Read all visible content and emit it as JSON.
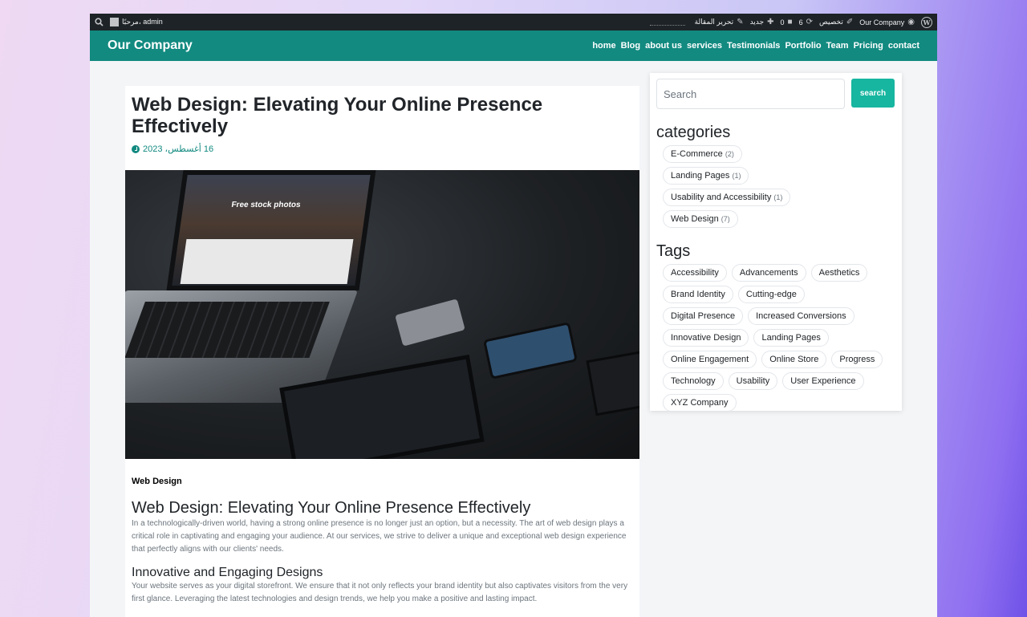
{
  "adminbar": {
    "site_name": "Our Company",
    "customize": "تخصيص",
    "updates_count": "6",
    "comments_count": "0",
    "new_label": "جديد",
    "edit_post": "تحرير المقالة",
    "greeting": "مرحبًا، admin"
  },
  "navbar": {
    "brand": "Our Company",
    "links": [
      "home",
      "Blog",
      "about us",
      "services",
      "Testimonials",
      "Portfolio",
      "Team",
      "Pricing",
      "contact"
    ]
  },
  "post": {
    "title": "Web Design: Elevating Your Online Presence Effectively",
    "date": "16 أغسطس، 2023",
    "image_text": "Free stock photos",
    "category": "Web Design",
    "heading": "Web Design: Elevating Your Online Presence Effectively",
    "para1": "In a technologically-driven world, having a strong online presence is no longer just an option, but a necessity. The art of web design plays a critical role in captivating and engaging your audience. At our services, we strive to deliver a unique and exceptional web design experience that perfectly aligns with our clients' needs.",
    "subheading": "Innovative and Engaging Designs",
    "para2": "Your website serves as your digital storefront. We ensure that it not only reflects your brand identity but also captivates visitors from the very first glance. Leveraging the latest technologies and design trends, we help you make a positive and lasting impact."
  },
  "sidebar": {
    "search_placeholder": "Search",
    "search_button": "search",
    "categories_title": "categories",
    "categories": [
      {
        "name": "E-Commerce",
        "count": "(2)"
      },
      {
        "name": "Landing Pages",
        "count": "(1)"
      },
      {
        "name": "Usability and Accessibility",
        "count": "(1)"
      },
      {
        "name": "Web Design",
        "count": "(7)"
      }
    ],
    "tags_title": "Tags",
    "tags": [
      "Accessibility",
      "Advancements",
      "Aesthetics",
      "Brand Identity",
      "Cutting-edge",
      "Digital Presence",
      "Increased Conversions",
      "Innovative Design",
      "Landing Pages",
      "Online Engagement",
      "Online Store",
      "Progress",
      "Technology",
      "Usability",
      "User Experience",
      "XYZ Company"
    ]
  },
  "colors": {
    "navbar": "#128a80",
    "accent": "#17b6a0",
    "adminbar": "#1d2327"
  },
  "icons": [
    "wordpress-icon",
    "dashboard-icon",
    "brush-icon",
    "refresh-icon",
    "comment-icon",
    "plus-icon",
    "pencil-icon",
    "avatar",
    "search-icon",
    "clock-icon"
  ]
}
